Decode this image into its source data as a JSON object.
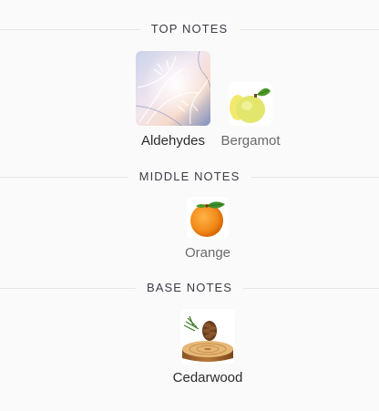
{
  "sections": [
    {
      "id": "top",
      "title": "TOP NOTES",
      "notes": [
        {
          "name": "Aldehydes",
          "image": "frost-pattern-image"
        },
        {
          "name": "Bergamot",
          "image": "bergamot-fruit-image"
        }
      ]
    },
    {
      "id": "middle",
      "title": "MIDDLE NOTES",
      "notes": [
        {
          "name": "Orange",
          "image": "orange-fruit-image"
        }
      ]
    },
    {
      "id": "base",
      "title": "BASE NOTES",
      "notes": [
        {
          "name": "Cedarwood",
          "image": "cedar-log-image"
        }
      ]
    }
  ]
}
